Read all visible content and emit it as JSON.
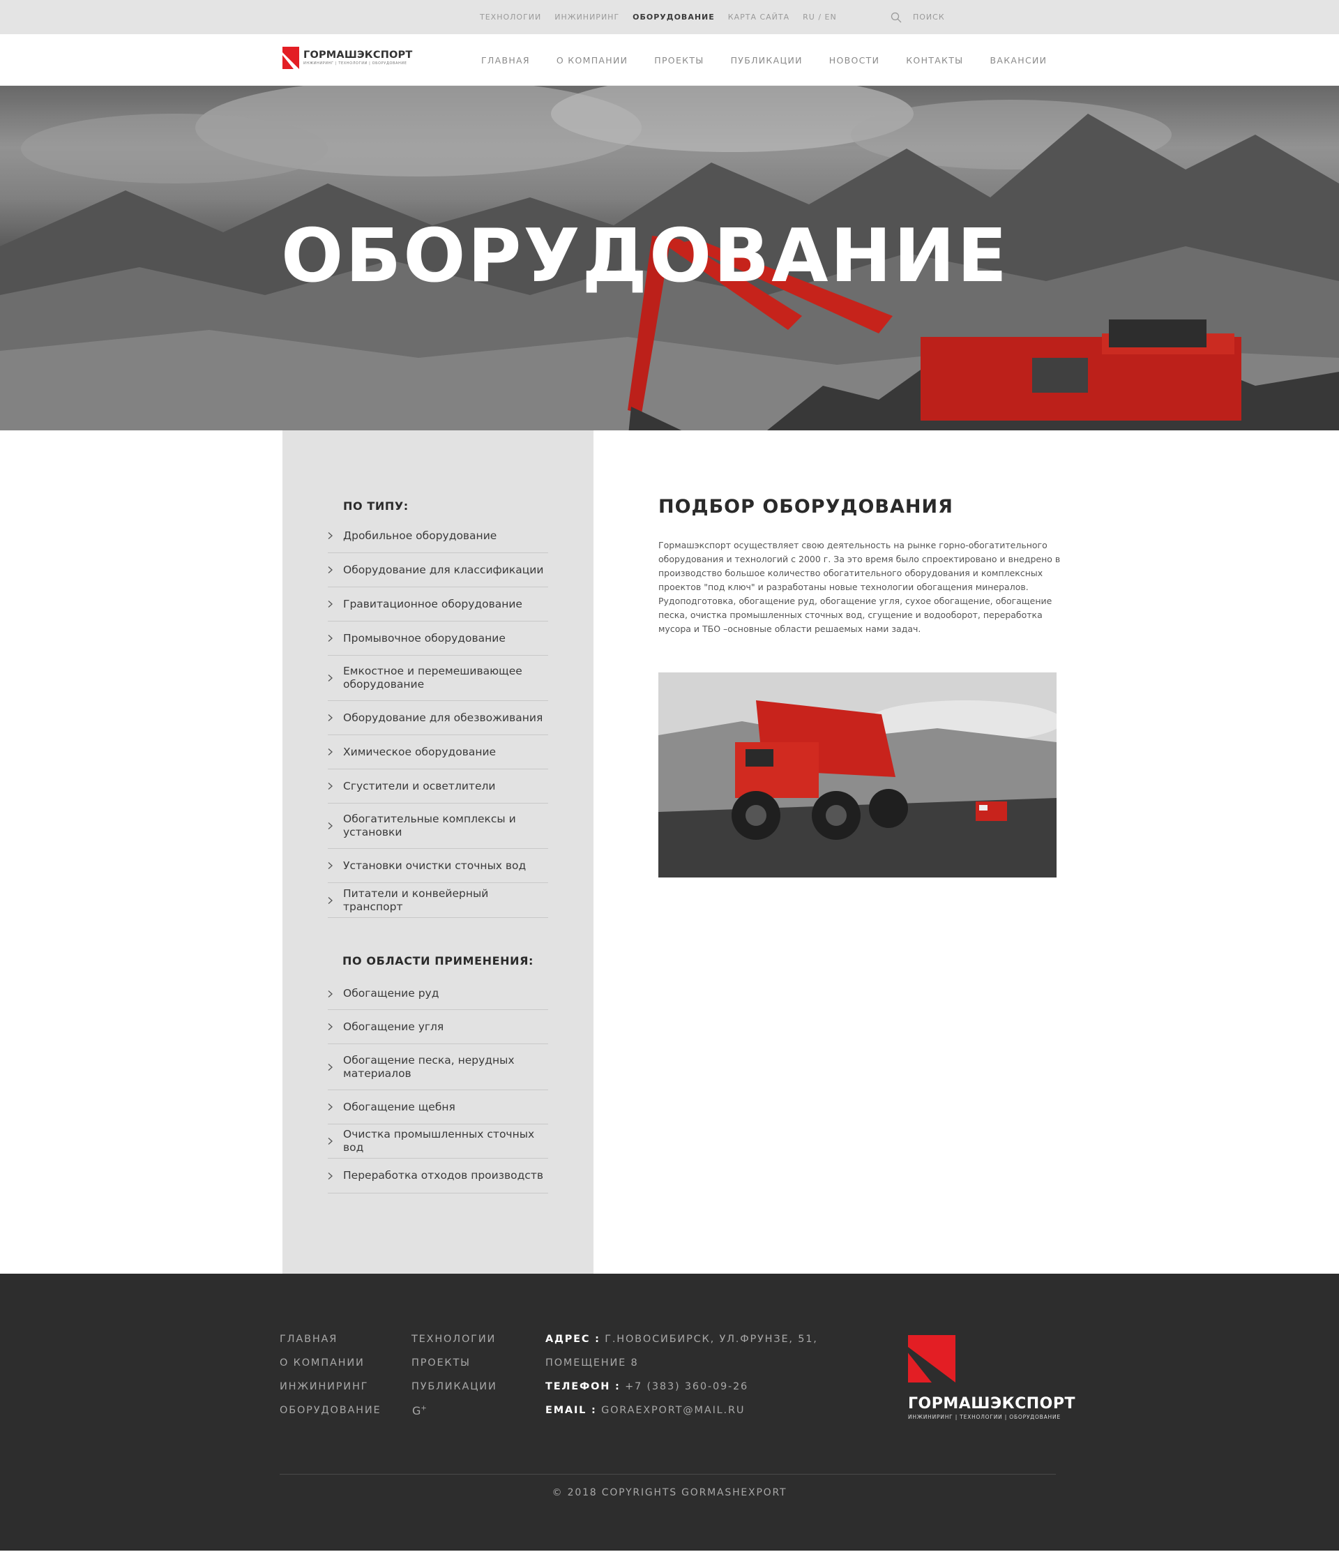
{
  "topbar": {
    "links": [
      {
        "label": "Технологии",
        "active": false
      },
      {
        "label": "Инжиниринг",
        "active": false
      },
      {
        "label": "Оборудование",
        "active": true
      },
      {
        "label": "Карта сайта",
        "active": false
      },
      {
        "label": "RU / EN",
        "active": false
      }
    ],
    "search_label": "Поиск"
  },
  "header": {
    "logo_name": "ГОРМАШЭКСПОРТ",
    "logo_tagline": "ИНЖИНИРИНГ | ТЕХНОЛОГИИ | ОБОРУДОВАНИЕ",
    "nav": [
      "Главная",
      "О компании",
      "Проекты",
      "Публикации",
      "Новости",
      "Контакты",
      "Вакансии"
    ]
  },
  "hero": {
    "title": "ОБОРУДОВАНИЕ"
  },
  "sidebar": {
    "by_type_heading": "По типу:",
    "by_type": [
      "Дробильное оборудование",
      "Оборудование для классификации",
      "Гравитационное оборудование",
      "Промывочное оборудование",
      "Емкостное и перемешивающее оборудование",
      "Оборудование для обезвоживания",
      "Химическое оборудование",
      "Сгустители и осветлители",
      "Обогатительные комплексы и установки",
      "Установки очистки сточных вод",
      "Питатели и конвейерный транспорт"
    ],
    "by_area_heading": "По области применения:",
    "by_area": [
      "Обогащение руд",
      "Обогащение угля",
      "Обогащение песка, нерудных материалов",
      "Обогащение щебня",
      "Очистка промышленных сточных вод",
      "Переработка отходов производств"
    ]
  },
  "main": {
    "title": "Подбор оборудования",
    "text": "Гормашэкспорт осуществляет свою деятельность на рынке горно-обогатительного оборудования и технологий с 2000 г. За это время было спроектировано и внедрено в производство большое количество обогатительного оборудования и комплексных проектов \"под ключ\" и разработаны новые технологии обогащения минералов. Рудоподготовка, обогащение руд, обогащение угля, сухое обогащение, обогащение песка, очистка промышленных сточных вод, сгущение и водооборот, переработка мусора и ТБО –основные области решаемых нами задач."
  },
  "footer": {
    "col1": [
      "Главная",
      "О компании",
      "Инжиниринг",
      "Оборудование"
    ],
    "col2": [
      "Технологии",
      "Проекты",
      "Публикации"
    ],
    "social_icon": "google-plus-icon",
    "address_label": "Адрес :",
    "address_value": "г.Новосибирск, ул.Фрунзе, 51,",
    "address_value2": "помещение 8",
    "phone_label": "Телефон :",
    "phone_value": "+7 (383) 360-09-26",
    "email_label": "Email :",
    "email_value": "goraexport@mail.ru",
    "logo_name": "ГОРМАШЭКСПОРТ",
    "logo_tagline": "ИНЖИНИРИНГ | ТЕХНОЛОГИИ | ОБОРУДОВАНИЕ",
    "copyright": "© 2018 Copyrights Gormashexport"
  },
  "colors": {
    "brand_red": "#e31e24",
    "topbar_bg": "#e4e4e4",
    "sidebar_bg": "#e2e2e2",
    "footer_bg": "#2d2d2d"
  }
}
